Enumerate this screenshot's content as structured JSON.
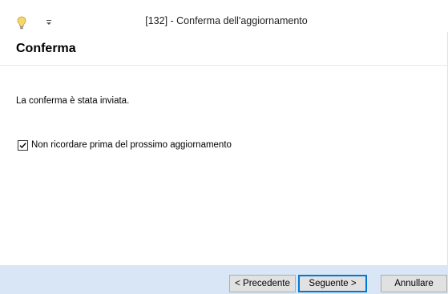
{
  "window": {
    "title": "[132] - Conferma dell'aggiornamento"
  },
  "page": {
    "heading": "Conferma",
    "message": "La conferma è stata inviata.",
    "checkbox": {
      "label": "Non ricordare prima del prossimo aggiornamento",
      "checked": true
    }
  },
  "buttons": {
    "previous": "< Precedente",
    "next": "Seguente >",
    "cancel": "Annullare"
  },
  "colors": {
    "footer_background": "#d8e6f5",
    "default_button_border": "#0078d7",
    "bulb": "#f5d76e"
  },
  "icons": {
    "app": "lightbulb-icon",
    "quick_access": "quick-access-dropdown-icon"
  }
}
